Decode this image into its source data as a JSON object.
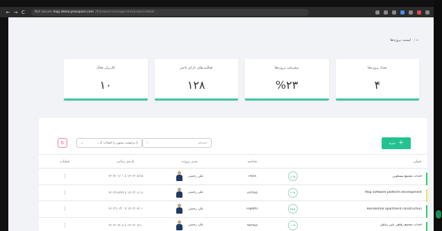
{
  "browser": {
    "nav": [
      "←",
      "→",
      "C"
    ],
    "security": "Not secure",
    "host": "map.demo.proxspars.com",
    "path": "/#/project-management/project-detail"
  },
  "breadcrumb": {
    "home": "⌂ /",
    "current": "لیست پروژه‌ها"
  },
  "stats": [
    {
      "title": "تعداد پروژه‌ها",
      "value": "۴"
    },
    {
      "title": "پیشرفت پروژه‌ها",
      "value": "%۲۳"
    },
    {
      "title": "فعالیت‌های دارای تاخیر",
      "value": "۱۲۸"
    },
    {
      "title": "کاربران فعال",
      "value": "۱۰"
    }
  ],
  "toolbar": {
    "add_label": "جدید",
    "search_placeholder": "جستجو",
    "column_select": "تا برچسب ستون را انتخاب ک...",
    "refresh": "↻"
  },
  "table": {
    "headers": {
      "title": "عنوان",
      "id": "شناسه",
      "manager": "مدیر پروژه",
      "range": "بازه‌ی زمانی",
      "ops": "عملیات"
    },
    "rows": [
      {
        "title": "احداث مجتمع مسکونی",
        "progress": "۲۰%",
        "id": "۱۲۵۶۸",
        "manager": "علی رحمتی",
        "range": "۱۴۰۳/۰۸/۱۵ تا ۱۴۰۴/۰۱/۰۱",
        "accent": "#2ecc71"
      },
      {
        "title": "Map software platform development",
        "progress": "۴۰%",
        "id": "۸۶۳۲۸۵",
        "manager": "علی رحمتی",
        "range": "۱۴۰۳/۰۱/۰۸ تا ۱۴۰۳/۱۲/۲۹",
        "accent": "#f1e15b"
      },
      {
        "title": "Residential apartment construction",
        "progress": "۲۵%",
        "id": "۶۸۵۵۴۴۶",
        "manager": "علی رحمتی",
        "range": "۱۴۰۳/۰۲/۰۱ تا ۱۴۰۳/۱۰/۳۰",
        "accent": "#2ecc71"
      },
      {
        "title": "احداث مجتمع رفاهی عین رباطی",
        "progress": "۱۰%",
        "id": "۴۵۶۹۸۵",
        "manager": "علی رحمتی",
        "range": "۱۴۰۳/۰۶/۱۰ تا ۱۴۰۳/۰۲/۰۸",
        "accent": "#2ecc71"
      }
    ]
  }
}
